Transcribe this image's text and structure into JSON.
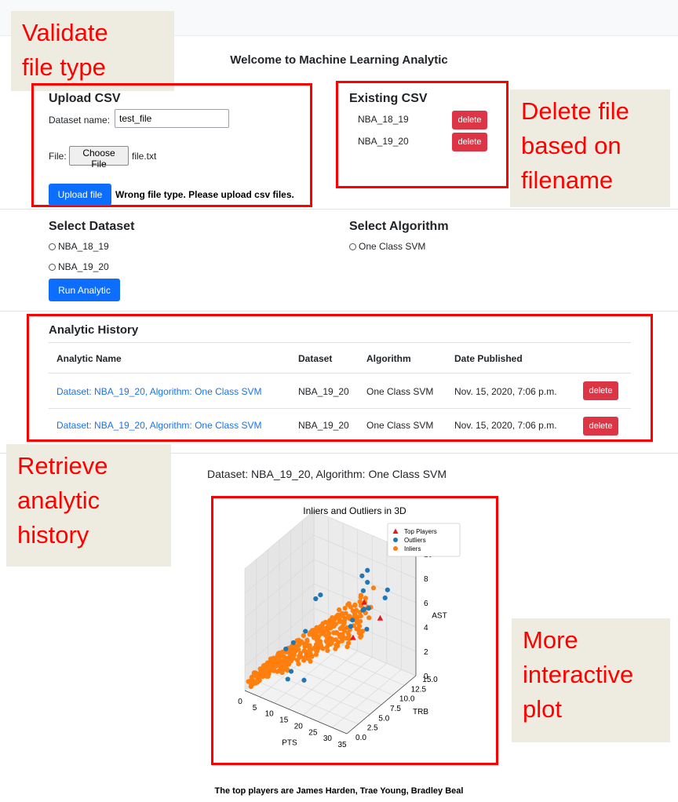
{
  "colors": {
    "callout_text": "#ff0000",
    "callout_bg": "#eeece1",
    "primary": "#0d6efd",
    "danger": "#dc3545",
    "link": "#1a73e8",
    "outlier": "#1f77b4",
    "inlier": "#ff7f0e",
    "top": "#e41a1c"
  },
  "callouts": {
    "validate": [
      "Validate",
      "file type"
    ],
    "delete": [
      "Delete file",
      "based on",
      "filename"
    ],
    "retrieve": [
      "Retrieve",
      "analytic",
      "history"
    ],
    "plot": [
      "More",
      "interactive",
      "plot"
    ]
  },
  "page_title": "Welcome to Machine Learning Analytic",
  "upload": {
    "heading": "Upload CSV",
    "dataset_label": "Dataset name:",
    "dataset_value": "test_file",
    "file_label": "File:",
    "choose_label": "Choose File",
    "file_name": "file.txt",
    "upload_button": "Upload file",
    "error": "Wrong file type. Please upload csv files."
  },
  "existing": {
    "heading": "Existing CSV",
    "files": [
      {
        "name": "NBA_18_19",
        "action": "delete"
      },
      {
        "name": "NBA_19_20",
        "action": "delete"
      }
    ]
  },
  "select_dataset": {
    "heading": "Select Dataset",
    "options": [
      "NBA_18_19",
      "NBA_19_20"
    ],
    "run_button": "Run Analytic"
  },
  "select_algorithm": {
    "heading": "Select Algorithm",
    "options": [
      "One Class SVM"
    ]
  },
  "history": {
    "heading": "Analytic History",
    "columns": [
      "Analytic Name",
      "Dataset",
      "Algorithm",
      "Date Published"
    ],
    "rows": [
      {
        "name": "Dataset: NBA_19_20, Algorithm: One Class SVM",
        "dataset": "NBA_19_20",
        "algorithm": "One Class SVM",
        "date": "Nov. 15, 2020, 7:06 p.m.",
        "action": "delete"
      },
      {
        "name": "Dataset: NBA_19_20, Algorithm: One Class SVM",
        "dataset": "NBA_19_20",
        "algorithm": "One Class SVM",
        "date": "Nov. 15, 2020, 7:06 p.m.",
        "action": "delete"
      }
    ]
  },
  "result_title": "Dataset: NBA_19_20, Algorithm: One Class SVM",
  "chart_data": {
    "type": "scatter",
    "title": "Inliers and Outliers in 3D",
    "xlabel": "PTS",
    "ylabel": "TRB",
    "zlabel": "AST",
    "x_ticks": [
      "0",
      "5",
      "10",
      "15",
      "20",
      "25",
      "30",
      "35"
    ],
    "y_ticks": [
      "0.0",
      "2.5",
      "5.0",
      "7.5",
      "10.0",
      "12.5",
      "15.0"
    ],
    "z_ticks": [
      "0",
      "2",
      "4",
      "6",
      "8",
      "10"
    ],
    "xlim": [
      0,
      35
    ],
    "ylim": [
      0,
      15
    ],
    "zlim": [
      0,
      10
    ],
    "legend": [
      "Top Players",
      "Outliers",
      "Inliers"
    ],
    "legend_position": "top-right",
    "series": [
      {
        "name": "Top Players",
        "marker": "triangle",
        "points": [
          [
            36,
            6.6,
            7.5
          ],
          [
            34,
            4.4,
            9.3
          ],
          [
            30.5,
            4.2,
            6.1
          ]
        ]
      },
      {
        "name": "Outliers",
        "marker": "circle",
        "points": [
          [
            31,
            7,
            10.8
          ],
          [
            25,
            10.8,
            8.0
          ],
          [
            28,
            8,
            8.5
          ],
          [
            33,
            6,
            8.2
          ],
          [
            26,
            14,
            5.8
          ],
          [
            22,
            12,
            5.1
          ],
          [
            15,
            13.5,
            2.5
          ],
          [
            26,
            9,
            9.2
          ],
          [
            18,
            4,
            8.1
          ],
          [
            22,
            2.5,
            9.3
          ],
          [
            30,
            7.5,
            5.7
          ],
          [
            5,
            10,
            2.2
          ],
          [
            4,
            8,
            1.8
          ],
          [
            3,
            7,
            1.5
          ],
          [
            8,
            5,
            0.8
          ],
          [
            10,
            3,
            1.0
          ],
          [
            14,
            4,
            1.0
          ],
          [
            18,
            12,
            3.8
          ],
          [
            30,
            12,
            7.5
          ],
          [
            20,
            13,
            4.5
          ]
        ]
      },
      {
        "name": "Inliers",
        "marker": "circle",
        "generated": true,
        "count": 380
      }
    ]
  },
  "summary": "The top players are James Harden, Trae Young, Bradley Beal"
}
